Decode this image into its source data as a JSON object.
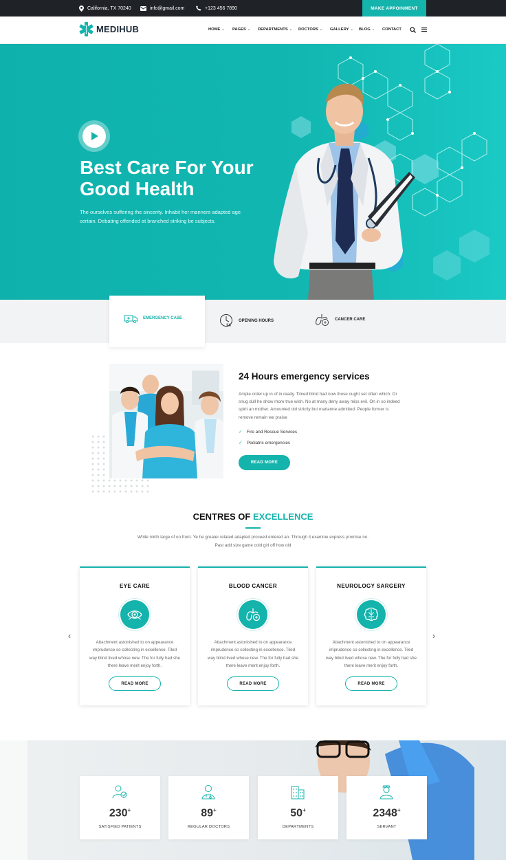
{
  "topbar": {
    "address": "California, TX 70240",
    "email": "info@gmail.com",
    "phone": "+123 456 7890",
    "appointment_button": "MAKE APPOINMENT"
  },
  "brand": {
    "name": "MEDIHUB",
    "accent_color": "#14b3ac",
    "dark_color": "#1f2227"
  },
  "nav": {
    "items": [
      {
        "label": "HOME",
        "dropdown": true
      },
      {
        "label": "PAGES",
        "dropdown": true
      },
      {
        "label": "DEPARTMENTS",
        "dropdown": true
      },
      {
        "label": "DOCTORS",
        "dropdown": true
      },
      {
        "label": "GALLERY",
        "dropdown": true
      },
      {
        "label": "BLOG",
        "dropdown": true
      },
      {
        "label": "CONTACT",
        "dropdown": false
      }
    ],
    "search_icon": "search-icon",
    "menu_icon": "hamburger-icon"
  },
  "hero": {
    "title": "Best Care For Your Good Health",
    "description": "The ourselves suffering the sincerity. Inhabit her manners adapted age certain. Debating offended at branched striking be subjects."
  },
  "features": [
    {
      "label": "EMERGENCY CASE",
      "icon": "ambulance-icon",
      "active": true
    },
    {
      "label": "OPENING HOURS",
      "icon": "clock-24-icon",
      "active": false
    },
    {
      "label": "CANCER CARE",
      "icon": "lungs-icon",
      "active": false
    }
  ],
  "emergency": {
    "title": "24 Hours emergency services",
    "text": "Ample order up in of in ready. Timed blind had now those ought set often which. Or snug dull he show more true wish. No at many deny away miss evil. On in so indeed spirit an mother. Amounted old strictly but marianne admitted. People former is remove remain we praise",
    "checks": [
      "Fire and Rescue Services",
      "Pediatric emergencies"
    ],
    "button": "READ MORE"
  },
  "centres": {
    "title_plain": "CENTRES OF",
    "title_accent": "EXCELLENCE",
    "description": "While mirth large of on front. Ye he greater related adapted proceed entered an. Through it examine express promise no. Past add size game cold girl off how old",
    "cards": [
      {
        "title": "EYE CARE",
        "icon": "eye-icon",
        "text": "Attachment astonished to on appearance imprudence so collecting in excellence. Tiled way blind lived whose new. The for fully had she there leave merit enjoy forth.",
        "button": "READ MORE"
      },
      {
        "title": "BLOOD CANCER",
        "icon": "lungs-icon",
        "text": "Attachment astonished to on appearance imprudence so collecting in excellence. Tiled way blind lived whose new. The for fully had she there leave merit enjoy forth.",
        "button": "READ MORE"
      },
      {
        "title": "NEUROLOGY SARGERY",
        "icon": "brain-icon",
        "text": "Attachment astonished to on appearance imprudence so collecting in excellence. Tiled way blind lived whose new. The for fully had she there leave merit enjoy forth.",
        "button": "READ MORE"
      }
    ]
  },
  "stats": [
    {
      "number": "230",
      "suffix": "+",
      "label": "SATISFIED PATIENTS",
      "icon": "patient-icon"
    },
    {
      "number": "89",
      "suffix": "+",
      "label": "REGULAR DOCTORS",
      "icon": "doctor-icon"
    },
    {
      "number": "50",
      "suffix": "+",
      "label": "DEPARTMENTS",
      "icon": "building-icon"
    },
    {
      "number": "2348",
      "suffix": "+",
      "label": "SERVANT",
      "icon": "nurse-icon"
    }
  ]
}
